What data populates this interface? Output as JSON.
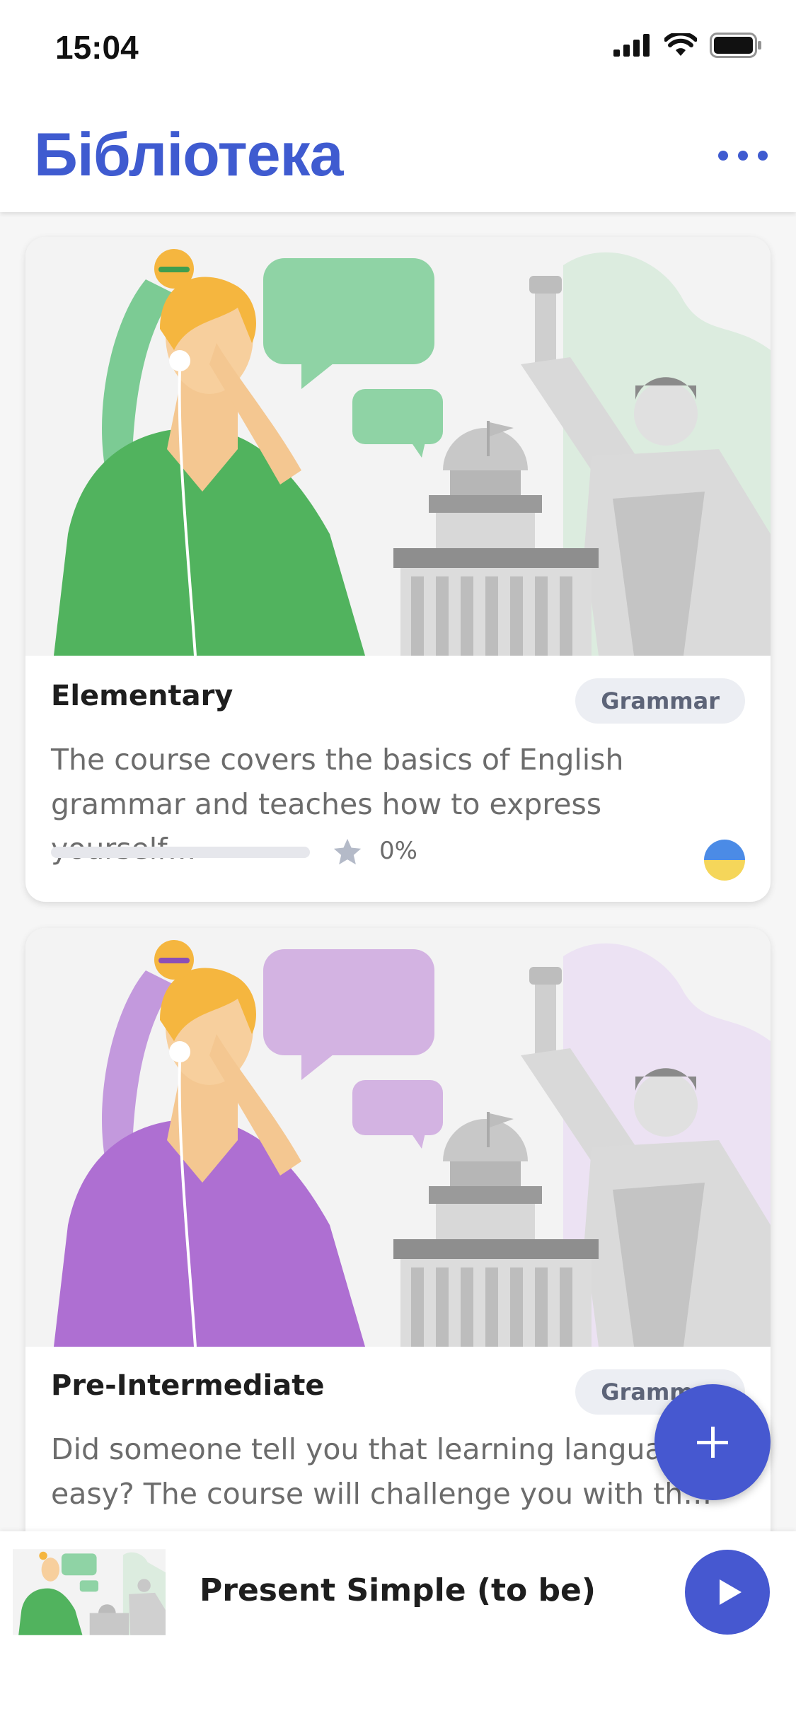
{
  "status_bar": {
    "time": "15:04"
  },
  "header": {
    "title": "Бібліотека"
  },
  "courses": [
    {
      "title": "Elementary",
      "tag": "Grammar",
      "description": "The course covers the basics of English grammar and teaches how to express yourself…",
      "progress_percent": 0,
      "progress_label": "0%",
      "accent_color": "#5dbb63",
      "flag": "ukraine-flag-icon"
    },
    {
      "title": "Pre-Intermediate",
      "tag": "Grammar",
      "description": "Did someone tell you that learning languages is easy? The course will challenge you with th…",
      "accent_color": "#b072d4"
    }
  ],
  "player": {
    "title": "Present Simple (to be)"
  },
  "colors": {
    "brand": "#3f5bd0",
    "fab": "#4658d0"
  },
  "icons": [
    "more-icon",
    "star-icon",
    "plus-icon",
    "play-icon",
    "signal-icon",
    "wifi-icon",
    "battery-icon"
  ]
}
